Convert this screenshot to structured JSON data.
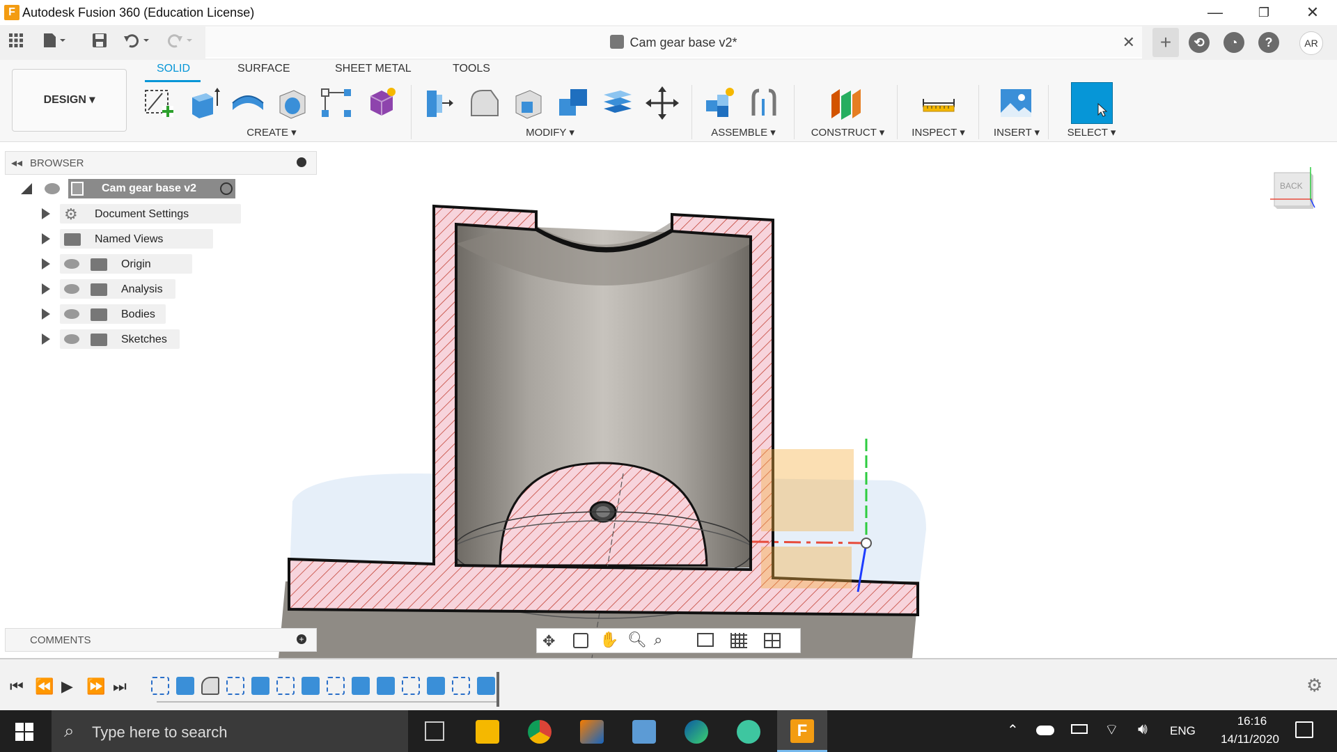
{
  "window": {
    "title": "Autodesk Fusion 360 (Education License)",
    "app_logo": "F"
  },
  "document": {
    "tab_title": "Cam gear base v2*",
    "user_initials": "AR"
  },
  "workspace": {
    "design_label": "DESIGN ▾"
  },
  "tabs": [
    {
      "label": "SOLID",
      "active": true
    },
    {
      "label": "SURFACE",
      "active": false
    },
    {
      "label": "SHEET METAL",
      "active": false
    },
    {
      "label": "TOOLS",
      "active": false
    }
  ],
  "groups": {
    "create": "CREATE ▾",
    "modify": "MODIFY ▾",
    "assemble": "ASSEMBLE ▾",
    "construct": "CONSTRUCT ▾",
    "inspect": "INSPECT ▾",
    "insert": "INSERT ▾",
    "select": "SELECT ▾"
  },
  "browser": {
    "title": "BROWSER",
    "root": "Cam gear base v2",
    "items": [
      {
        "label": "Document Settings"
      },
      {
        "label": "Named Views"
      },
      {
        "label": "Origin"
      },
      {
        "label": "Analysis"
      },
      {
        "label": "Bodies"
      },
      {
        "label": "Sketches"
      }
    ]
  },
  "comments": {
    "title": "COMMENTS"
  },
  "viewcube": {
    "face_label": "BACK"
  },
  "taskbar": {
    "search_placeholder": "Type here to search",
    "language": "ENG",
    "time": "16:16",
    "date": "14/11/2020"
  },
  "colors": {
    "accent": "#0696d7",
    "section_fill": "#f7d4dc",
    "section_hatch": "#c0392b",
    "body_gray": "#9a9690"
  }
}
